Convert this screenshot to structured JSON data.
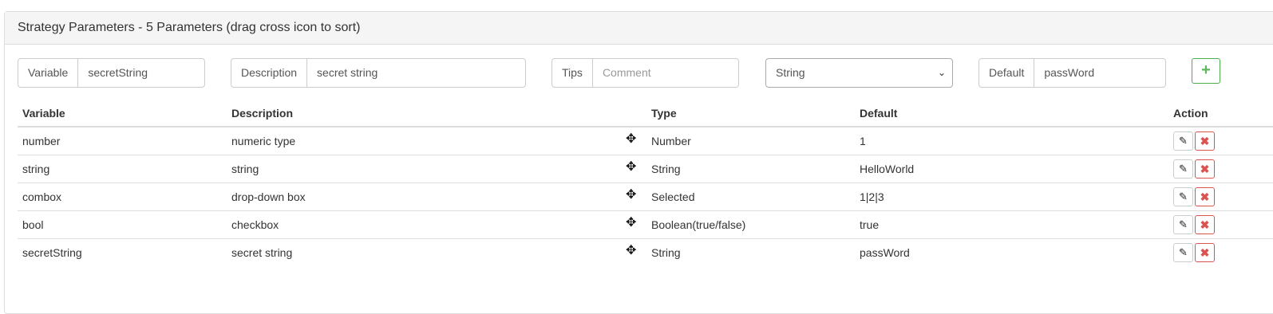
{
  "panel": {
    "title": "Strategy Parameters - 5 Parameters (drag cross icon to sort)"
  },
  "form": {
    "variable_label": "Variable",
    "variable_value": "secretString",
    "description_label": "Description",
    "description_value": "secret string",
    "tips_label": "Tips",
    "tips_placeholder": "Comment",
    "type_selected": "String",
    "default_label": "Default",
    "default_value": "passWord",
    "add_button": "+"
  },
  "table": {
    "headers": {
      "variable": "Variable",
      "description": "Description",
      "type": "Type",
      "default": "Default",
      "action": "Action"
    },
    "rows": [
      {
        "variable": "number",
        "description": "numeric type",
        "type": "Number",
        "default": "1"
      },
      {
        "variable": "string",
        "description": "string",
        "type": "String",
        "default": "HelloWorld"
      },
      {
        "variable": "combox",
        "description": "drop-down box",
        "type": "Selected",
        "default": "1|2|3"
      },
      {
        "variable": "bool",
        "description": "checkbox",
        "type": "Boolean(true/false)",
        "default": "true"
      },
      {
        "variable": "secretString",
        "description": "secret string",
        "type": "String",
        "default": "passWord"
      }
    ]
  },
  "icons": {
    "move": "move-icon",
    "edit": "pencil-icon",
    "delete": "close-icon",
    "dropdown": "chevron-down-icon"
  },
  "colors": {
    "add_green": "#5cb85c",
    "delete_red": "#d9534f",
    "heading_bg": "#f5f5f5"
  }
}
